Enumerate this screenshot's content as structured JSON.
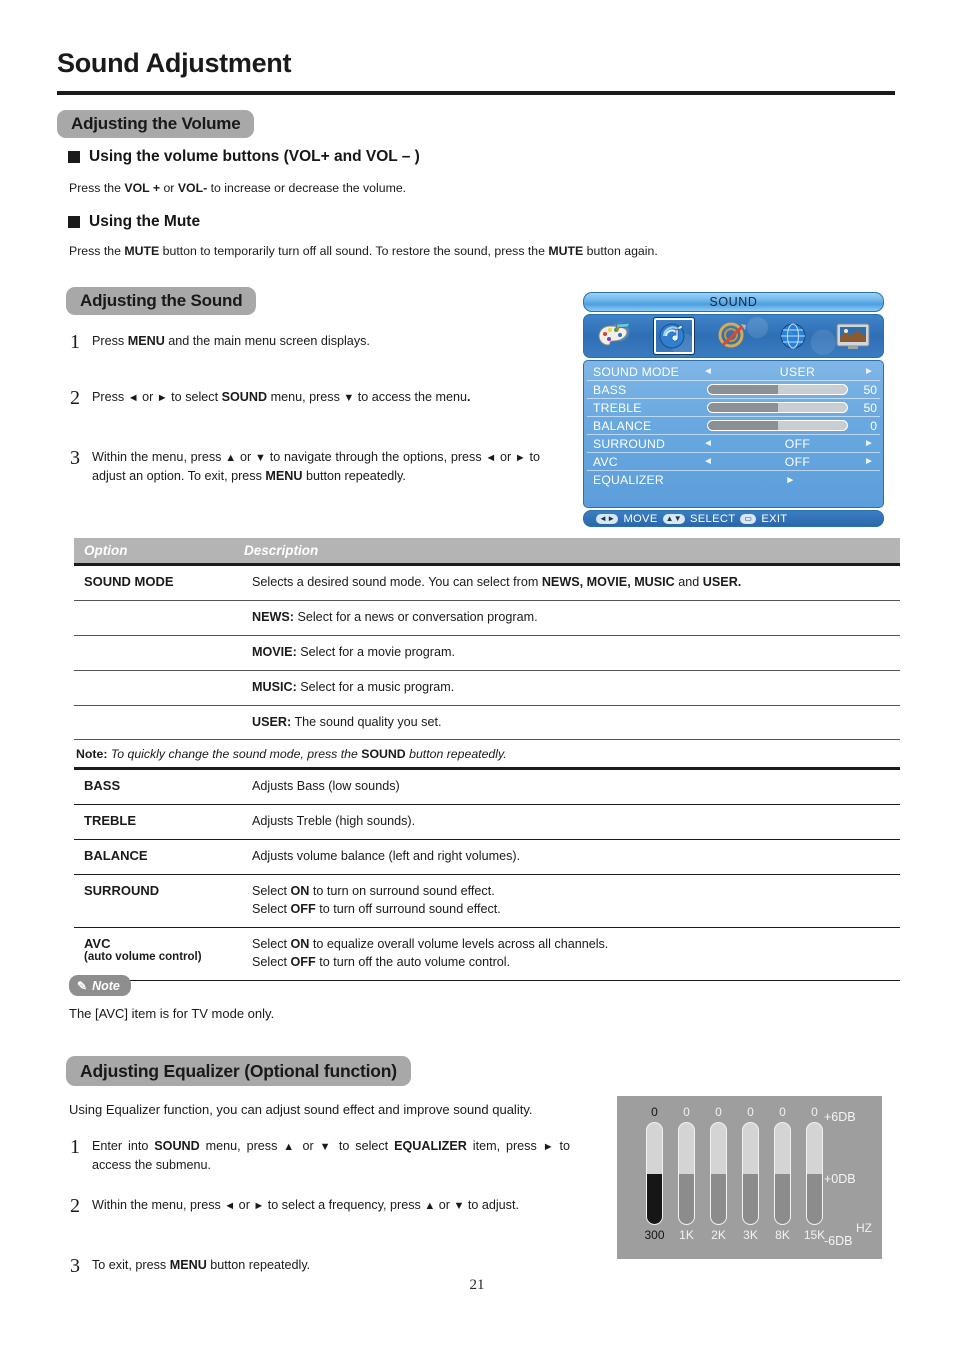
{
  "page": {
    "title": "Sound Adjustment",
    "number": "21"
  },
  "volume_section": {
    "heading": "Adjusting the Volume",
    "sub1": {
      "heading": "Using the volume buttons (VOL+ and VOL – )",
      "text_1": "Press the ",
      "bold_1": "VOL +",
      "text_2": " or ",
      "bold_2": "VOL-",
      "text_3": " to increase or decrease the volume."
    },
    "sub2": {
      "heading": "Using the Mute",
      "text_1": "Press the ",
      "bold_1": "MUTE",
      "text_2": " button to temporarily turn off all sound.   To restore the sound, press the ",
      "bold_2": "MUTE",
      "text_3": " button again."
    }
  },
  "sound_section": {
    "heading": "Adjusting the Sound",
    "steps": [
      {
        "num": "1",
        "parts": [
          {
            "t": "Press "
          },
          {
            "t": "MENU",
            "b": true
          },
          {
            "t": " and the main menu screen displays."
          }
        ]
      },
      {
        "num": "2",
        "parts": [
          {
            "t": "Press "
          },
          {
            "t": "◄",
            "arrow": true
          },
          {
            "t": " or "
          },
          {
            "t": "►",
            "arrow": true
          },
          {
            "t": " to select "
          },
          {
            "t": "SOUND",
            "b": true
          },
          {
            "t": " menu,  press "
          },
          {
            "t": "▼",
            "arrow": true
          },
          {
            "t": " to access the menu"
          },
          {
            "t": ".",
            "b": true
          }
        ]
      },
      {
        "num": "3",
        "parts": [
          {
            "t": "Within the menu, press "
          },
          {
            "t": "▲",
            "arrow": true
          },
          {
            "t": " or "
          },
          {
            "t": "▼",
            "arrow": true
          },
          {
            "t": " to navigate through the options, press "
          },
          {
            "t": "◄",
            "arrow": true
          },
          {
            "t": " or "
          },
          {
            "t": "►",
            "arrow": true
          },
          {
            "t": " to adjust an option. To exit, press "
          },
          {
            "t": "MENU",
            "b": true
          },
          {
            "t": " button repeatedly."
          }
        ]
      }
    ]
  },
  "osd": {
    "title": "SOUND",
    "icons": [
      {
        "name": "picture-palette-icon",
        "label": "PICTURE",
        "selected": false
      },
      {
        "name": "sound-note-icon",
        "label": "SOUND",
        "selected": true
      },
      {
        "name": "setup-compass-icon",
        "label": "SETUP",
        "selected": false
      },
      {
        "name": "globe-icon",
        "label": "CHANNEL",
        "selected": false
      },
      {
        "name": "screen-tv-icon",
        "label": "SCREEN",
        "selected": false
      }
    ],
    "rows": [
      {
        "label": "SOUND MODE",
        "type": "option",
        "value": "USER"
      },
      {
        "label": "BASS",
        "type": "slider",
        "value": "50",
        "fill": 50
      },
      {
        "label": "TREBLE",
        "type": "slider",
        "value": "50",
        "fill": 50
      },
      {
        "label": "BALANCE",
        "type": "slider",
        "value": "0",
        "fill": 50
      },
      {
        "label": "SURROUND",
        "type": "option",
        "value": "OFF"
      },
      {
        "label": "AVC",
        "type": "option",
        "value": "OFF"
      },
      {
        "label": "EQUALIZER",
        "type": "submenu",
        "value": ""
      }
    ],
    "footer": {
      "move": "MOVE",
      "select": "SELECT",
      "exit": "EXIT"
    }
  },
  "table": {
    "headers": {
      "option": "Option",
      "description": "Description"
    },
    "sound_mode": {
      "option": "SOUND MODE",
      "rows": [
        {
          "parts": [
            {
              "t": "Selects a desired sound mode.  You can select from "
            },
            {
              "t": "NEWS, MOVIE, MUSIC",
              "b": true
            },
            {
              "t": " and "
            },
            {
              "t": "USER.",
              "b": true
            }
          ]
        },
        {
          "parts": [
            {
              "t": "NEWS:",
              "b": true
            },
            {
              "t": " Select for a news or conversation program."
            }
          ]
        },
        {
          "parts": [
            {
              "t": "MOVIE:",
              "b": true
            },
            {
              "t": " Select for a movie program."
            }
          ]
        },
        {
          "parts": [
            {
              "t": "MUSIC:",
              "b": true
            },
            {
              "t": " Select for a music program."
            }
          ]
        },
        {
          "parts": [
            {
              "t": "USER:",
              "b": true
            },
            {
              "t": " The sound quality you set."
            }
          ]
        }
      ]
    },
    "note_row": {
      "label": "Note:",
      "text_1": " To quickly change the sound mode, press the ",
      "bold": "SOUND",
      "text_2": " button repeatedly."
    },
    "rows": [
      {
        "option": "BASS",
        "sub": "",
        "lines": [
          [
            {
              "t": "Adjusts Bass (low sounds)"
            }
          ]
        ]
      },
      {
        "option": "TREBLE",
        "sub": "",
        "lines": [
          [
            {
              "t": " Adjusts Treble (high sounds)."
            }
          ]
        ]
      },
      {
        "option": "BALANCE",
        "sub": "",
        "lines": [
          [
            {
              "t": "Adjusts volume balance (left and right volumes)."
            }
          ]
        ]
      },
      {
        "option": "SURROUND",
        "sub": "",
        "lines": [
          [
            {
              "t": "Select "
            },
            {
              "t": "ON",
              "b": true
            },
            {
              "t": " to turn on surround sound effect."
            }
          ],
          [
            {
              "t": "Select "
            },
            {
              "t": "OFF",
              "b": true
            },
            {
              "t": " to turn off surround sound effect."
            }
          ]
        ]
      },
      {
        "option": "AVC",
        "sub": "(auto volume control)",
        "lines": [
          [
            {
              "t": "Select "
            },
            {
              "t": "ON",
              "b": true
            },
            {
              "t": " to equalize overall volume levels across all channels."
            }
          ],
          [
            {
              "t": "Select "
            },
            {
              "t": "OFF",
              "b": true
            },
            {
              "t": " to turn off the auto volume control."
            }
          ]
        ]
      }
    ]
  },
  "note": {
    "badge": "Note",
    "text": "The [AVC] item is for TV mode only."
  },
  "equalizer_section": {
    "heading": "Adjusting Equalizer (Optional function)",
    "intro": "Using Equalizer function, you can adjust sound effect and improve sound quality.",
    "steps": [
      {
        "num": "1",
        "parts": [
          {
            "t": "Enter into "
          },
          {
            "t": "SOUND",
            "b": true
          },
          {
            "t": " menu, press "
          },
          {
            "t": "▲",
            "arrow": true
          },
          {
            "t": " or "
          },
          {
            "t": "▼",
            "arrow": true
          },
          {
            "t": " to select "
          },
          {
            "t": "EQUALIZER",
            "b": true
          },
          {
            "t": " item,  press "
          },
          {
            "t": "►",
            "arrow": true
          },
          {
            "t": " to access the submenu."
          }
        ]
      },
      {
        "num": "2",
        "parts": [
          {
            "t": "Within the menu, press "
          },
          {
            "t": "◄",
            "arrow": true
          },
          {
            "t": " or "
          },
          {
            "t": "►",
            "arrow": true
          },
          {
            "t": " to select a frequency, press "
          },
          {
            "t": "▲",
            "arrow": true
          },
          {
            "t": " or "
          },
          {
            "t": "▼",
            "arrow": true
          },
          {
            "t": " to adjust."
          }
        ]
      },
      {
        "num": "3",
        "parts": [
          {
            "t": " To exit, press "
          },
          {
            "t": "MENU",
            "b": true
          },
          {
            "t": " button repeatedly."
          }
        ]
      }
    ]
  },
  "chart_data": {
    "type": "bar",
    "title": "Equalizer",
    "categories": [
      "300",
      "1K",
      "2K",
      "3K",
      "8K",
      "15K"
    ],
    "values": [
      0,
      0,
      0,
      0,
      0,
      0
    ],
    "value_labels": [
      "0",
      "0",
      "0",
      "0",
      "0",
      "0"
    ],
    "xlabel": "HZ",
    "ylabel": "DB",
    "ylim": [
      -6,
      6
    ],
    "axis_ticks": [
      "+6DB",
      "+0DB",
      "-6DB"
    ],
    "hz_label": "HZ",
    "selected_index": 0,
    "grid": false,
    "legend": "none"
  }
}
